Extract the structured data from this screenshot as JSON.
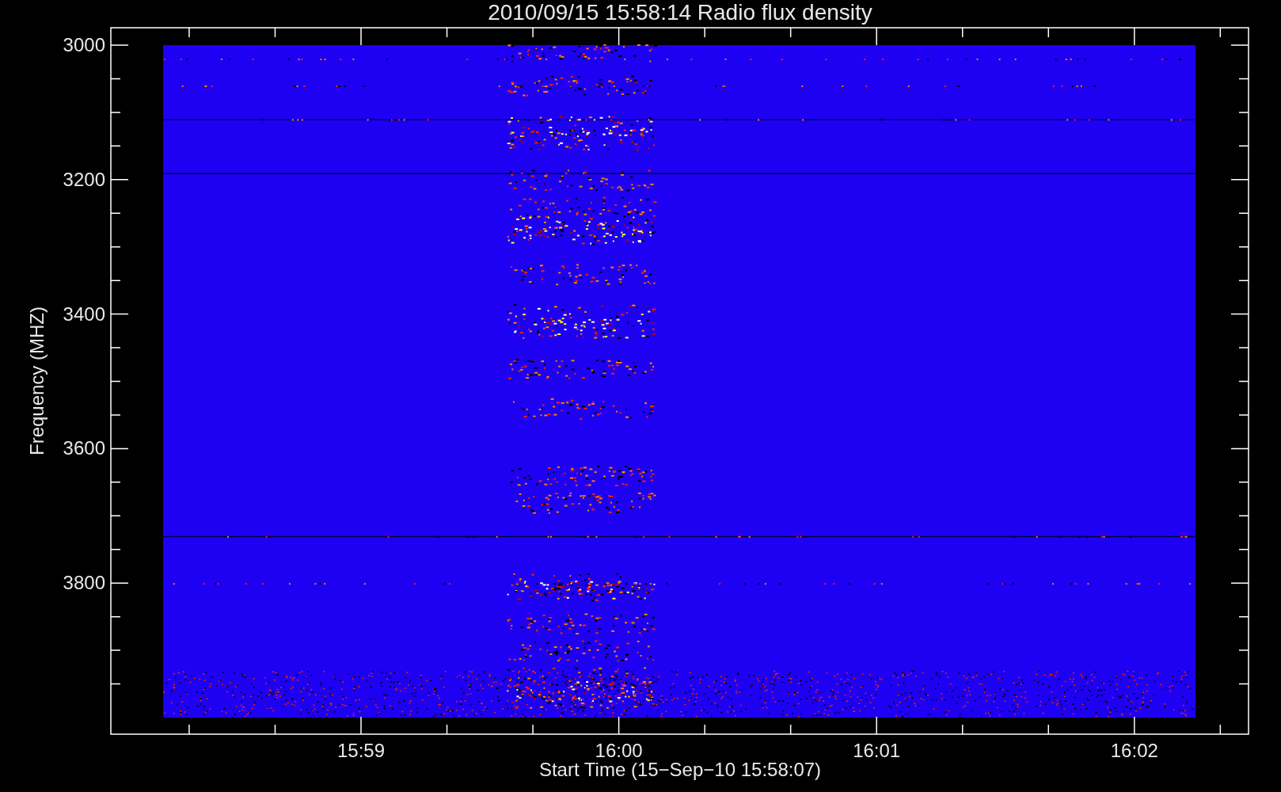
{
  "plot": {
    "title": "2010/09/15 15:58:14 Radio flux density",
    "ylabel": "Frequency (MHZ)",
    "xlabel": "Start Time (15−Sep−10 15:58:07)",
    "yticks": [
      "3000",
      "3200",
      "3400",
      "3600",
      "3800"
    ],
    "xticks": [
      "15:59",
      "16:00",
      "16:01",
      "16:02"
    ]
  }
}
